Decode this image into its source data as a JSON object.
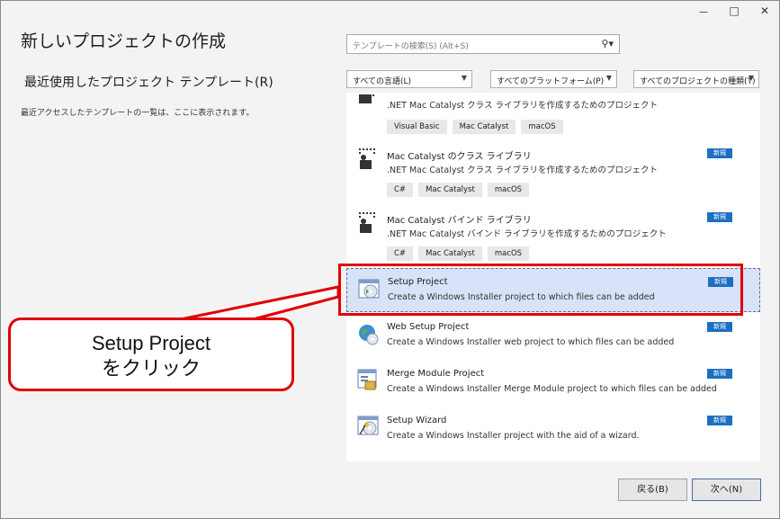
{
  "window": {
    "controls": [
      "－",
      "□",
      "✕"
    ]
  },
  "page": {
    "title": "新しいプロジェクトの作成",
    "recent_title": "最近使用したプロジェクト テンプレート(R)",
    "recent_description": "最近アクセスしたテンプレートの一覧は、ここに表示されます。"
  },
  "search": {
    "placeholder": "テンプレートの検索(S) (Alt+S)",
    "icon": "search-icon"
  },
  "filters": [
    {
      "label": "すべての言語(L)"
    },
    {
      "label": "すべてのプラットフォーム(P)"
    },
    {
      "label": "すべてのプロジェクトの種類(T)"
    }
  ],
  "templates": [
    {
      "name": "",
      "desc": ".NET Mac Catalyst クラス ライブラリを作成するためのプロジェクト",
      "tags": [
        "Visual Basic",
        "Mac Catalyst",
        "macOS"
      ],
      "badge": "",
      "icon": "class-library-icon"
    },
    {
      "name": "Mac Catalyst のクラス ライブラリ",
      "desc": ".NET Mac Catalyst クラス ライブラリを作成するためのプロジェクト",
      "tags": [
        "C#",
        "Mac Catalyst",
        "macOS"
      ],
      "badge": "新規",
      "icon": "class-library-icon"
    },
    {
      "name": "Mac Catalyst バインド ライブラリ",
      "desc": ".NET Mac Catalyst バインド ライブラリを作成するためのプロジェクト",
      "tags": [
        "C#",
        "Mac Catalyst",
        "macOS"
      ],
      "badge": "新規",
      "icon": "binding-library-icon"
    },
    {
      "name": "Setup Project",
      "desc": "Create a Windows Installer project to which files can be added",
      "tags": [],
      "badge": "新規",
      "icon": "setup-project-icon"
    },
    {
      "name": "Web Setup Project",
      "desc": "Create a Windows Installer web project to which files can be added",
      "tags": [],
      "badge": "新規",
      "icon": "web-setup-icon"
    },
    {
      "name": "Merge Module Project",
      "desc": "Create a Windows Installer Merge Module project to which files can be added",
      "tags": [],
      "badge": "新規",
      "icon": "merge-module-icon"
    },
    {
      "name": "Setup Wizard",
      "desc": "Create a Windows Installer project with the aid of a wizard.",
      "tags": [],
      "badge": "新規",
      "icon": "setup-wizard-icon"
    }
  ],
  "callout": {
    "line1": "Setup Project",
    "line2": "をクリック"
  },
  "buttons": {
    "back": "戻る(B)",
    "next": "次へ(N)"
  },
  "colors": {
    "highlight": "#e00000",
    "badge": "#1e6fc2",
    "selected": "#d8e2f8"
  }
}
